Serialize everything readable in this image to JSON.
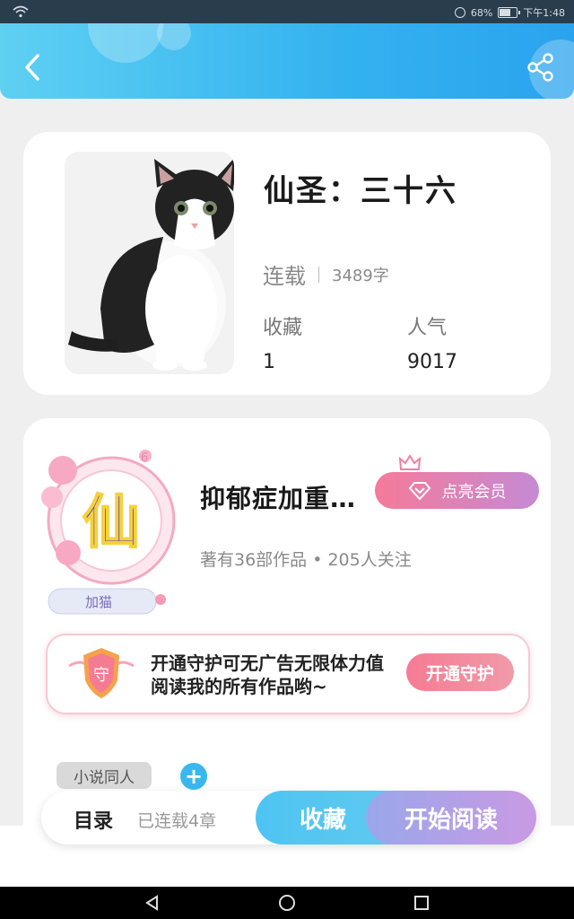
{
  "status_bar": {
    "battery": "68%",
    "time": "下午1:48"
  },
  "header": {
    "back_icon": "chevron-left-icon",
    "share_icon": "share-icon"
  },
  "book": {
    "title": "仙圣：三十六",
    "status": "连载",
    "word_count": "3489字",
    "favorites_label": "收藏",
    "favorites_value": "1",
    "popularity_label": "人气",
    "popularity_value": "9017"
  },
  "author": {
    "avatar_char": "仙",
    "avatar_tag": "加猫",
    "name": "抑郁症加重…",
    "vip_button": "点亮会员",
    "works": "著有36部作品 • 205人关注"
  },
  "guard": {
    "badge_char": "守",
    "text": "开通守护可无广告无限体力值阅读我的所有作品哟~",
    "button": "开通守护"
  },
  "tags": {
    "tag": "小说同人",
    "add": "+"
  },
  "action_bar": {
    "toc": "目录",
    "chapters": "已连载4章",
    "collect": "收藏",
    "read": "开始阅读"
  },
  "colors": {
    "header": "#33b2f0",
    "accent_blue": "#3ab8ee",
    "accent_pink": "#f57a9a",
    "read_purple": "#b4a0e7"
  }
}
